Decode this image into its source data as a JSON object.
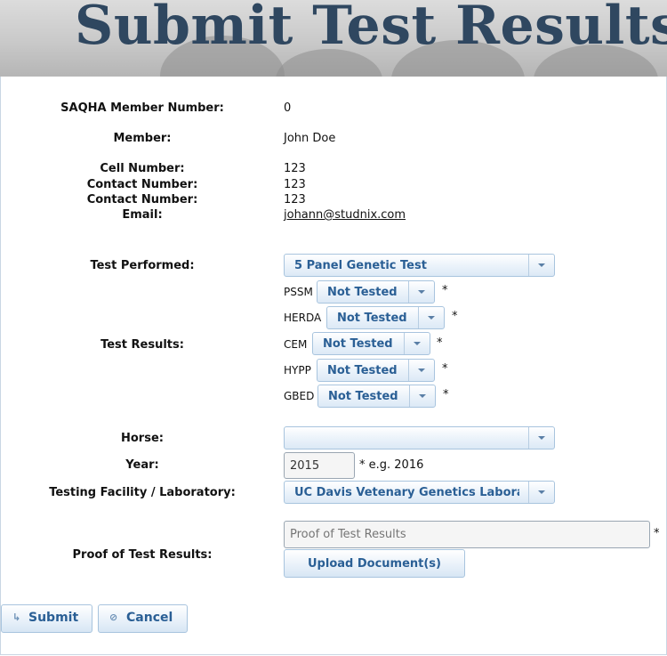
{
  "banner": {
    "title": "Submit Test Results"
  },
  "member_info": {
    "member_number_label": "SAQHA Member Number:",
    "member_number": "0",
    "member_label": "Member:",
    "member_name": "John Doe",
    "cell_label": "Cell Number:",
    "cell_value": "123",
    "contact1_label": "Contact Number:",
    "contact1_value": "123",
    "contact2_label": "Contact Number:",
    "contact2_value": "123",
    "email_label": "Email:",
    "email_value": "johann@studnix.com"
  },
  "test": {
    "performed_label": "Test Performed:",
    "performed_value": "5 Panel Genetic Test",
    "results_label": "Test Results:",
    "results": [
      {
        "name": "PSSM",
        "value": "Not Tested",
        "required": "*"
      },
      {
        "name": "HERDA",
        "value": "Not Tested",
        "required": "*"
      },
      {
        "name": "CEM",
        "value": "Not Tested",
        "required": "*"
      },
      {
        "name": "HYPP",
        "value": "Not Tested",
        "required": "*"
      },
      {
        "name": "GBED",
        "value": "Not Tested",
        "required": "*"
      }
    ]
  },
  "horse": {
    "label": "Horse:",
    "value": ""
  },
  "year": {
    "label": "Year:",
    "value": "2015",
    "hint": "* e.g. 2016"
  },
  "lab": {
    "label": "Testing Facility / Laboratory:",
    "value": "UC Davis Vetenary Genetics Laboratory"
  },
  "proof": {
    "label": "Proof of Test Results:",
    "placeholder": "Proof of Test Results",
    "required": "*",
    "upload_label": "Upload Document(s)"
  },
  "actions": {
    "submit_label": "Submit",
    "cancel_label": "Cancel"
  },
  "colors": {
    "banner_text": "#2f4760",
    "accent": "#2a5f95",
    "border": "#a8c4de"
  }
}
